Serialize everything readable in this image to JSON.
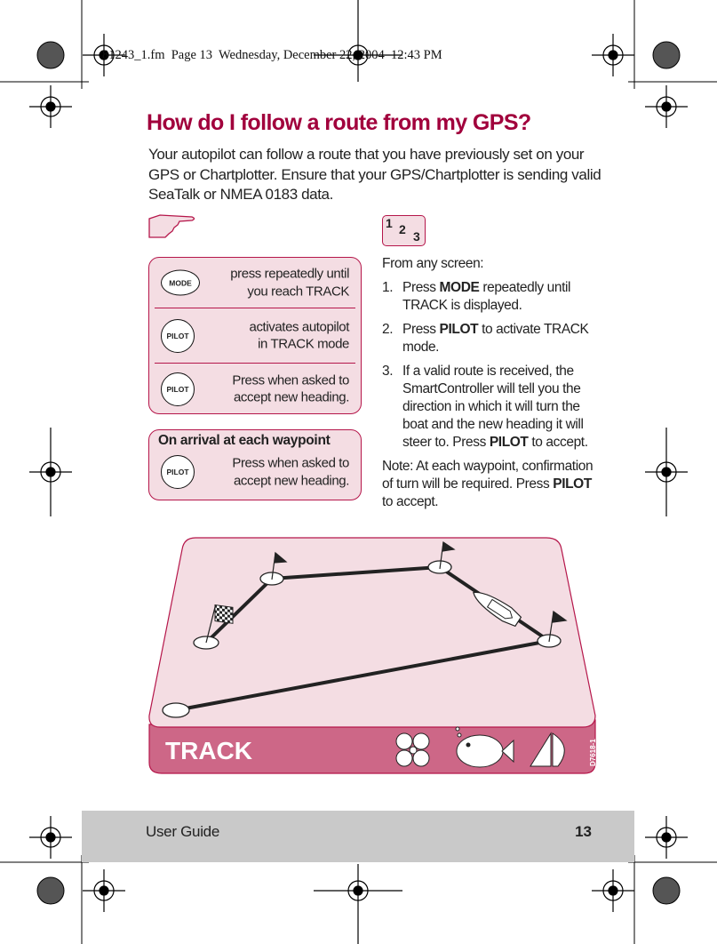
{
  "print_header": "81243_1.fm  Page 13  Wednesday, December 22, 2004  12:43 PM",
  "title": "How do I follow a route from my GPS?",
  "intro": "Your autopilot can follow a route that you have previously set on your GPS or Chartplotter. Ensure that your GPS/Chartplotter is sending valid SeaTalk or NMEA 0183 data.",
  "steps_icon": [
    "1",
    "2",
    "3"
  ],
  "quick_box": {
    "rows": [
      {
        "button": "MODE",
        "text": [
          "press repeatedly until",
          "you reach TRACK"
        ]
      },
      {
        "button": "PILOT",
        "text": [
          "activates autopilot",
          "in TRACK mode"
        ]
      },
      {
        "button": "PILOT",
        "text": [
          "Press when asked to",
          "accept new heading."
        ]
      }
    ]
  },
  "waypoint_box": {
    "heading": "On arrival at each waypoint",
    "button": "PILOT",
    "text": [
      "Press when asked to",
      "accept new heading."
    ]
  },
  "instructions": {
    "lead": "From any screen:",
    "items": [
      {
        "num": "1.",
        "pre": "Press ",
        "key": "MODE",
        "post": " repeatedly until TRACK is displayed."
      },
      {
        "num": "2.",
        "pre": "Press ",
        "key": "PILOT",
        "post": " to activate TRACK mode."
      },
      {
        "num": "3.",
        "pre": "If a valid route is received, the SmartController will tell you the direction in which it will turn the boat and the new heading it will steer to. Press ",
        "key": "PILOT",
        "post": " to accept."
      }
    ],
    "note_pre": "Note:  At each waypoint, confirmation of turn will be required. Press ",
    "note_key": "PILOT",
    "note_post": " to accept."
  },
  "illustration": {
    "mode_label": "TRACK",
    "figure_id": "D7618-1"
  },
  "footer": {
    "label": "User Guide",
    "page": "13"
  },
  "colors": {
    "title": "#a1003c",
    "box_fill": "#f4dde3",
    "box_border": "#b5164a",
    "track_bar": "#cd6787",
    "footer_bg": "#c9c9c9"
  }
}
